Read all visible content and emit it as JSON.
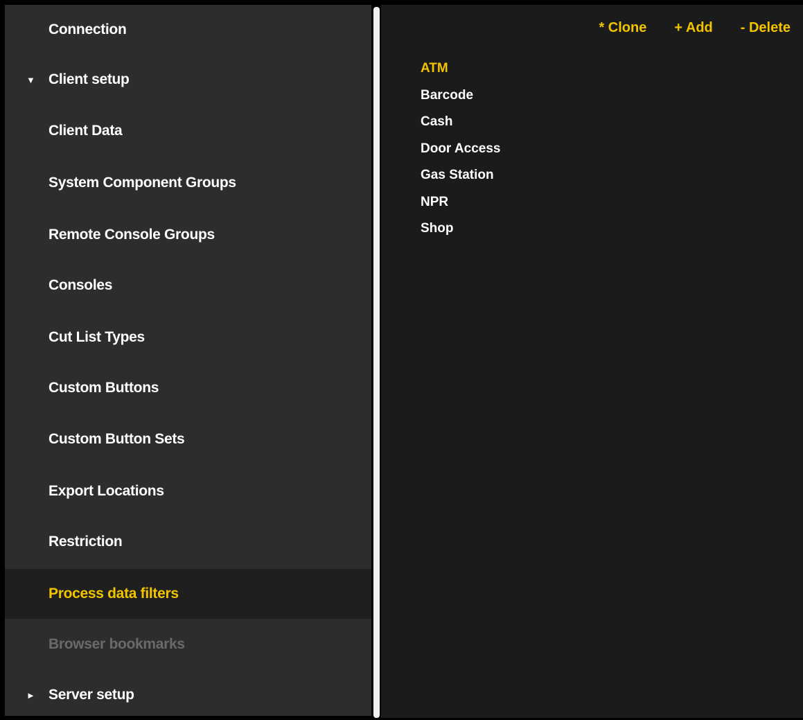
{
  "sidebar": {
    "items": [
      {
        "label": "Connection",
        "arrow": ""
      },
      {
        "label": "Client setup",
        "arrow": "▼"
      },
      {
        "label": "Client Data",
        "arrow": ""
      },
      {
        "label": "System Component Groups",
        "arrow": ""
      },
      {
        "label": "Remote Console Groups",
        "arrow": ""
      },
      {
        "label": "Consoles",
        "arrow": ""
      },
      {
        "label": "Cut List Types",
        "arrow": ""
      },
      {
        "label": "Custom Buttons",
        "arrow": ""
      },
      {
        "label": "Custom Button Sets",
        "arrow": ""
      },
      {
        "label": "Export Locations",
        "arrow": ""
      },
      {
        "label": "Restriction",
        "arrow": ""
      },
      {
        "label": "Process data filters",
        "arrow": ""
      },
      {
        "label": "Browser bookmarks",
        "arrow": ""
      },
      {
        "label": "Server setup",
        "arrow": "►"
      }
    ]
  },
  "toolbar": {
    "clone_label": "* Clone",
    "add_label": "+ Add",
    "delete_label": "- Delete"
  },
  "filters": {
    "items": [
      "ATM",
      "Barcode",
      "Cash",
      "Door Access",
      "Gas Station",
      "NPR",
      "Shop"
    ]
  },
  "colors": {
    "accent": "#f2c400",
    "sidebar_bg": "#2d2d2d",
    "content_bg": "#1b1b1b",
    "active_bg": "#1f1f1f",
    "disabled_text": "#6a6a6a"
  }
}
